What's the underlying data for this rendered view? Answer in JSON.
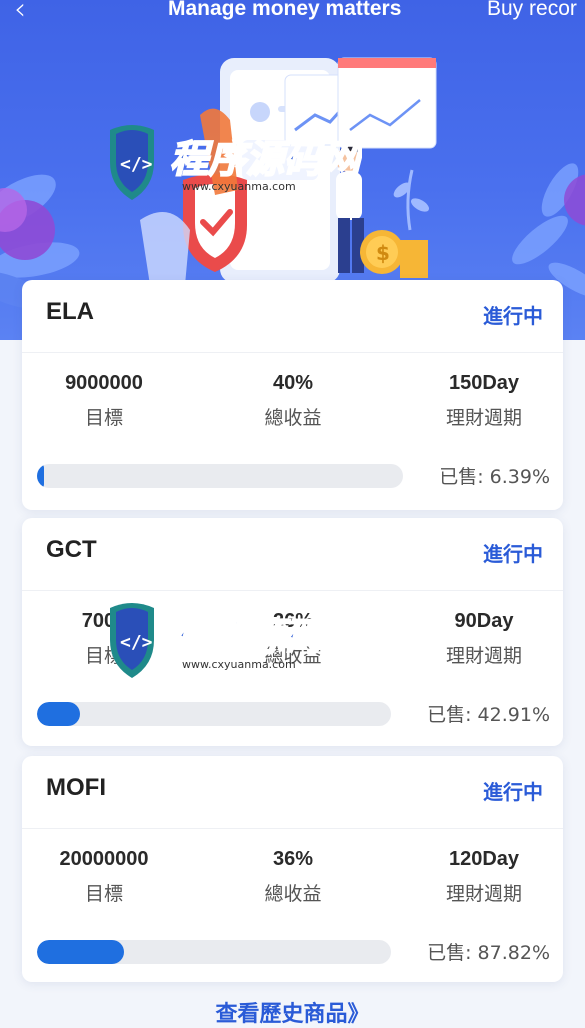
{
  "header": {
    "back_icon": "chevron-left-icon",
    "title": "Manage money matters",
    "buy_records": "Buy recor"
  },
  "products": [
    {
      "name": "ELA",
      "status": "進行中",
      "target": "9000000",
      "target_label": "目標",
      "yield": "40%",
      "yield_label": "總收益",
      "period": "150Day",
      "period_label": "理財週期",
      "sold_label": "已售:",
      "sold_value": "6.39%",
      "progress": 0.0639
    },
    {
      "name": "GCT",
      "status": "進行中",
      "target": "7000",
      "target_label": "目標",
      "yield": "26%",
      "yield_label": "總收益",
      "period": "90Day",
      "period_label": "理財週期",
      "sold_label": "已售:",
      "sold_value": "42.91%",
      "progress": 0.4291
    },
    {
      "name": "MOFI",
      "status": "進行中",
      "target": "20000000",
      "target_label": "目標",
      "yield": "36%",
      "yield_label": "總收益",
      "period": "120Day",
      "period_label": "理財週期",
      "sold_label": "已售:",
      "sold_value": "87.82%",
      "progress": 0.8782
    }
  ],
  "footer": {
    "history_link": "查看歷史商品》"
  },
  "watermark": {
    "text": "程序源码网",
    "url": "www.cxyuanma.com"
  },
  "colors": {
    "hero_blue": "#4a70ee",
    "accent": "#2a5bd7",
    "progress_fill": "#1f6fe0"
  }
}
